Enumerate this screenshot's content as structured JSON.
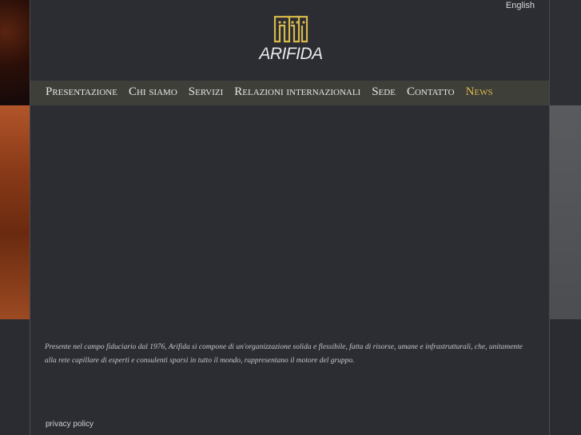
{
  "header": {
    "language_link": "English",
    "logo_text": "ARIFIDA"
  },
  "nav": {
    "items": [
      {
        "label": "Presentazione"
      },
      {
        "label": "Chi siamo"
      },
      {
        "label": "Servizi"
      },
      {
        "label": "Relazioni internazionali"
      },
      {
        "label": "Sede"
      },
      {
        "label": "Contatto"
      },
      {
        "label": "News"
      }
    ]
  },
  "footer": {
    "description": "Presente nel campo fiduciario dal 1976, Arifida si compone di un'organizzazione solida e flessibile, fatta di risorse, umane e infrastrutturali, che, unitamente alla rete capillare di esperti e consulenti sparsi in tutto il mondo, rappresentano il motore del gruppo.",
    "privacy_link": "privacy policy"
  },
  "colors": {
    "accent": "#d8b84a",
    "nav_bg": "#3f3f3a",
    "page_bg": "#2b2d33"
  }
}
